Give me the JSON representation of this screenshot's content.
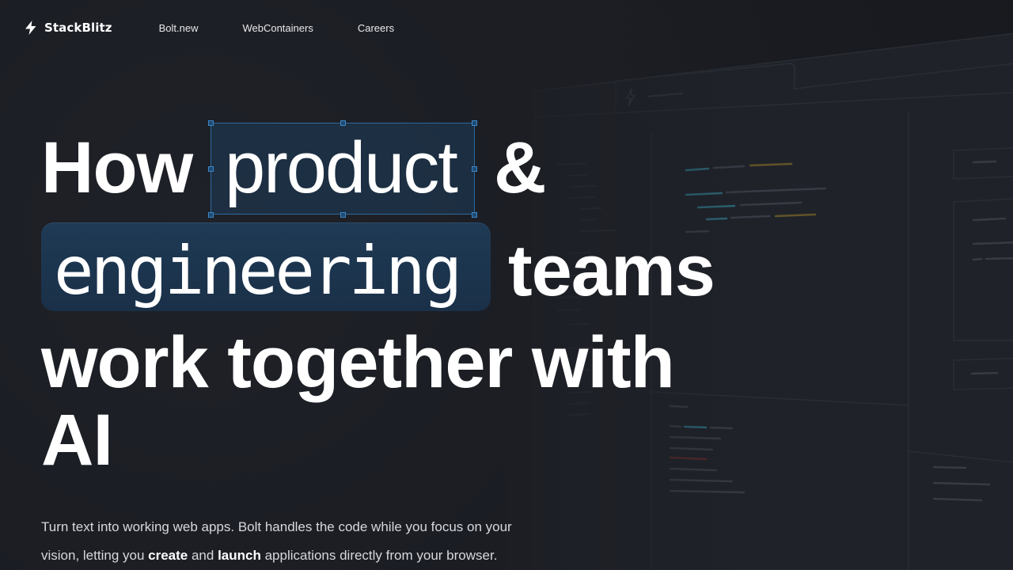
{
  "nav": {
    "logo_text": "StackBlitz",
    "links": [
      {
        "label": "Bolt.new"
      },
      {
        "label": "WebContainers"
      },
      {
        "label": "Careers"
      }
    ]
  },
  "hero": {
    "line1_before": "How",
    "line1_highlight": "product",
    "line1_after": "&",
    "line2_highlight": "engineering",
    "line2_after": "teams",
    "line3": "work together with",
    "line4": "AI"
  },
  "subtitle": {
    "part1": "Turn text into working web apps. Bolt handles the code while you focus on your",
    "part2": "vision, letting you ",
    "bold1": "create",
    "part3": " and ",
    "bold2": "launch",
    "part4": " applications directly from your browser."
  },
  "colors": {
    "background": "#1c1e24",
    "highlight_box": "#1f3a55",
    "selection_border": "#2c6aa0",
    "code_teal": "#3aa6b9",
    "code_yellow": "#b79a3a"
  }
}
